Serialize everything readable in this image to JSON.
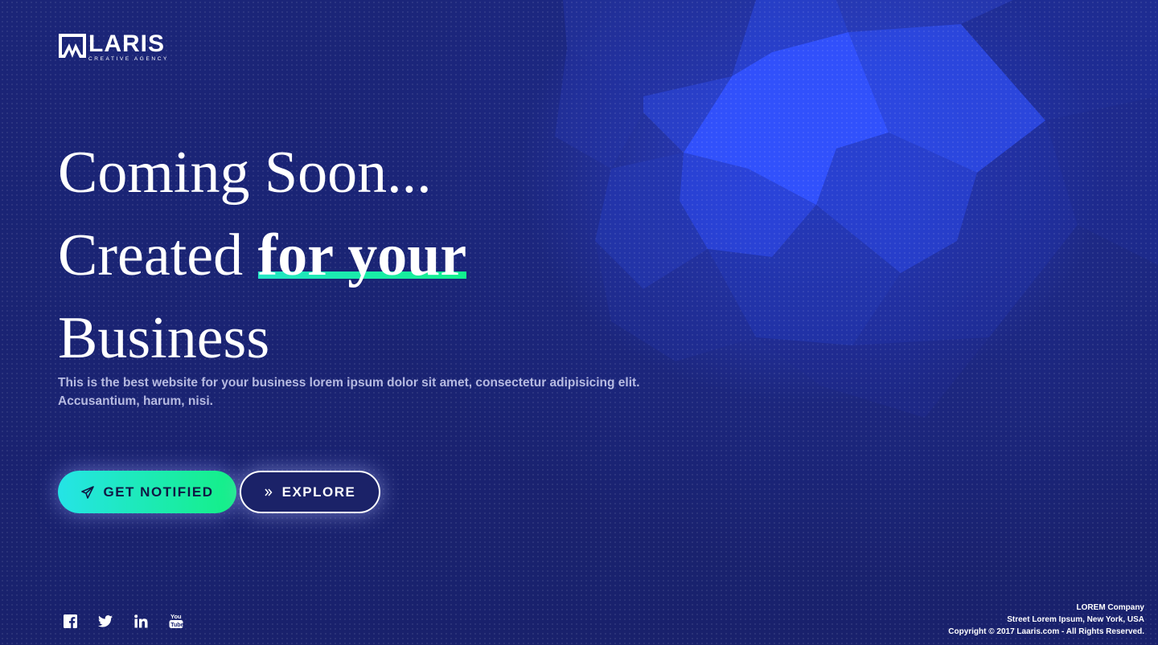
{
  "brand": {
    "name": "LARIS",
    "tagline": "CREATIVE AGENCY"
  },
  "hero": {
    "line1": "Coming Soon...",
    "line2_plain": "Created ",
    "line2_highlight": "for your",
    "line3": "Business",
    "description": "This is the best website for your business lorem ipsum dolor sit amet, consectetur adipisicing elit. Accusantium, harum, nisi."
  },
  "buttons": {
    "notify_label": "GET NOTIFIED",
    "notify_icon": "paper-plane-icon",
    "explore_label": "EXPLORE",
    "explore_icon": "double-chevron-right-icon"
  },
  "social": [
    "facebook-icon",
    "twitter-icon",
    "linkedin-icon",
    "youtube-icon"
  ],
  "footer": {
    "company": "LOREM Company",
    "address": "Street Lorem Ipsum, New York, USA",
    "copyright": "Copyright © 2017 Laaris.com - All Rights Reserved."
  },
  "colors": {
    "background": "#1a2474",
    "accent_start": "#25e4e6",
    "accent_end": "#14f085",
    "poly_highlight": "#3a56ff"
  }
}
